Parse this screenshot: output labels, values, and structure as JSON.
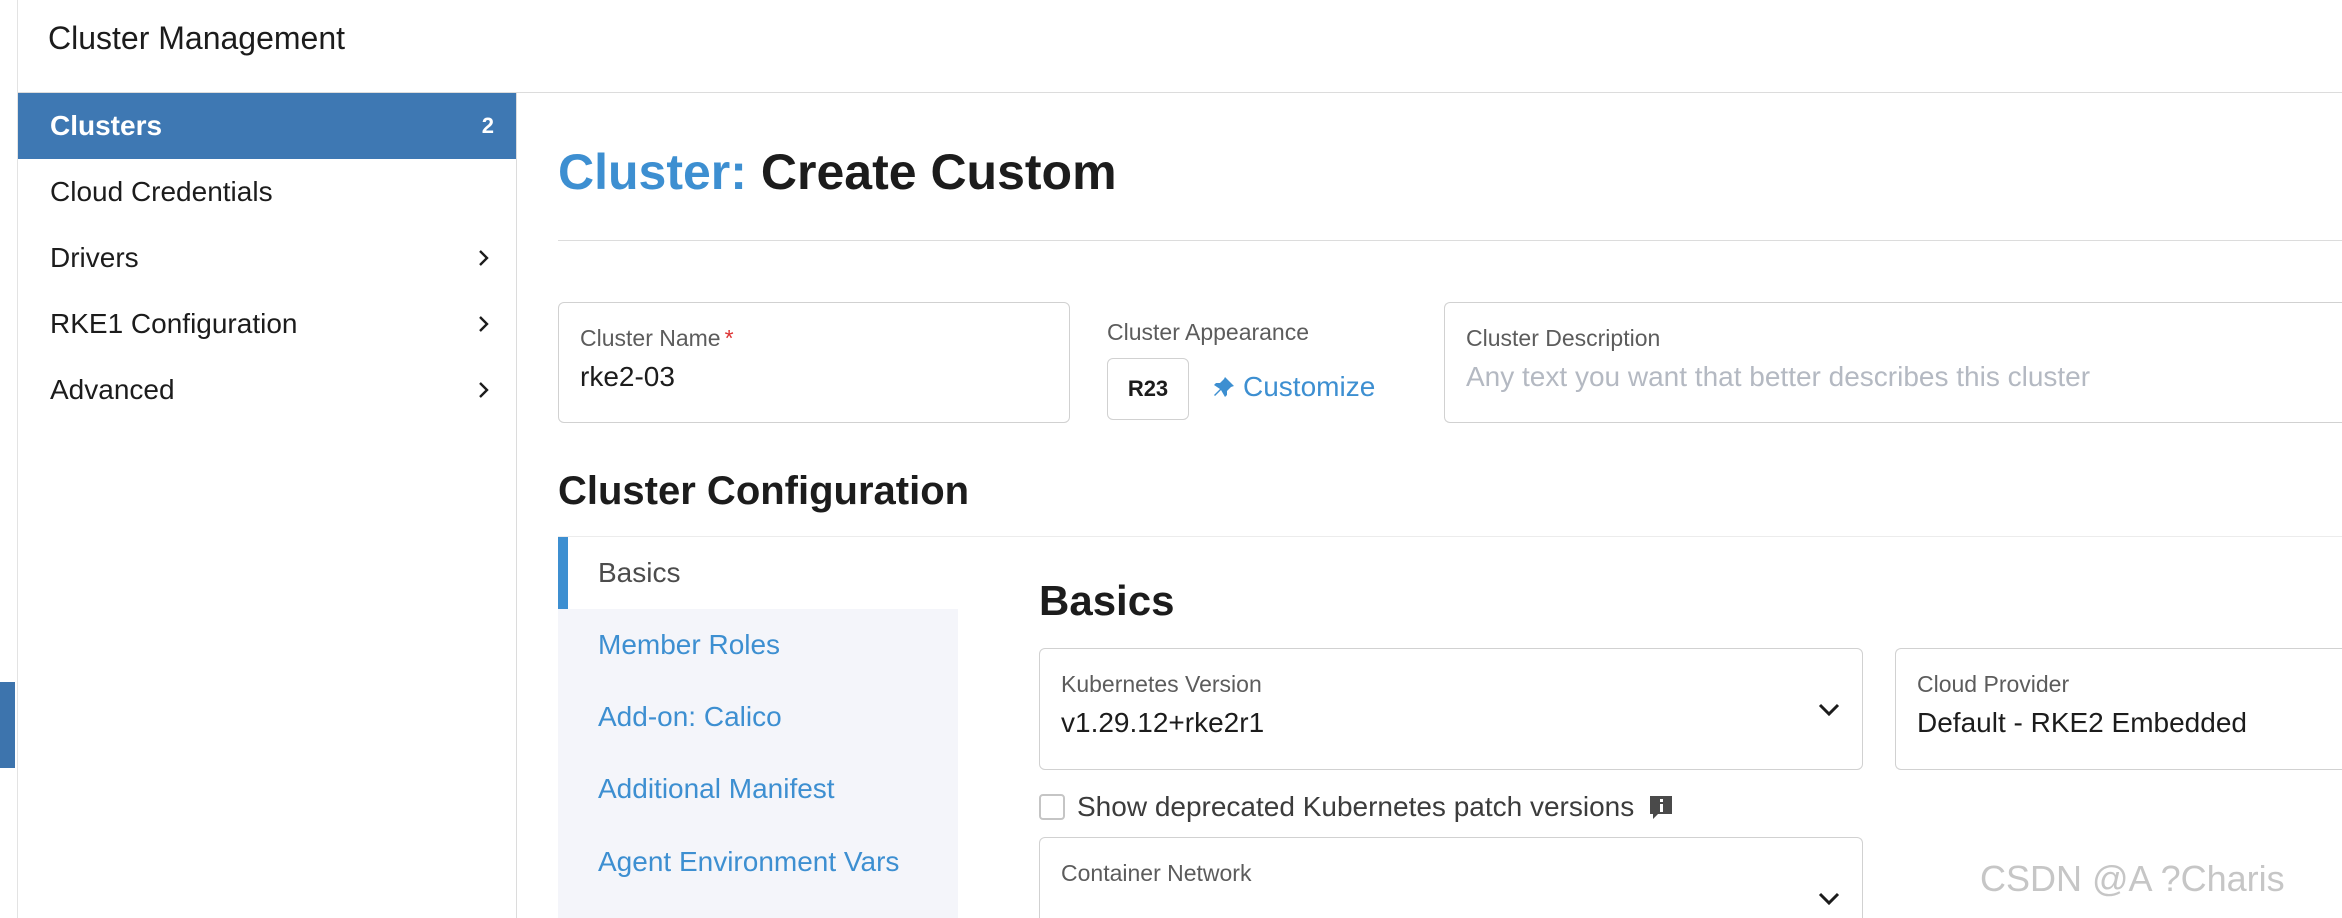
{
  "app": {
    "title": "Cluster Management"
  },
  "sidebar": {
    "items": [
      {
        "label": "Clusters",
        "badge": "2",
        "active": true
      },
      {
        "label": "Cloud Credentials"
      },
      {
        "label": "Drivers",
        "icon": "chevron-right-icon"
      },
      {
        "label": "RKE1 Configuration",
        "icon": "chevron-right-icon"
      },
      {
        "label": "Advanced",
        "icon": "chevron-right-icon"
      }
    ]
  },
  "page": {
    "title_prefix": "Cluster:",
    "title": "Create Custom"
  },
  "form": {
    "cluster_name": {
      "label": "Cluster Name",
      "required_mark": "*",
      "value": "rke2-03"
    },
    "appearance": {
      "label": "Cluster Appearance",
      "avatar_text": "R23",
      "customize_label": "Customize",
      "customize_icon": "pin-icon"
    },
    "description": {
      "label": "Cluster Description",
      "placeholder": "Any text you want that better describes this cluster"
    }
  },
  "config": {
    "section_title": "Cluster Configuration",
    "nav": [
      {
        "label": "Basics",
        "active": true
      },
      {
        "label": "Member Roles"
      },
      {
        "label": "Add-on: Calico"
      },
      {
        "label": "Additional Manifest"
      },
      {
        "label": "Agent Environment Vars"
      }
    ],
    "basics": {
      "title": "Basics",
      "kubernetes_version": {
        "label": "Kubernetes Version",
        "value": "v1.29.12+rke2r1"
      },
      "cloud_provider": {
        "label": "Cloud Provider",
        "value": "Default - RKE2 Embedded"
      },
      "show_deprecated": {
        "label": "Show deprecated Kubernetes patch versions",
        "checked": false,
        "icon": "info-icon"
      },
      "container_network": {
        "label": "Container Network"
      }
    }
  },
  "watermark": "CSDN @A ?Charis",
  "colors": {
    "accent": "#3d8fd1",
    "sidebar_active": "#3e78b3",
    "nav_bg": "#f4f5fa",
    "required": "#dd3333"
  }
}
